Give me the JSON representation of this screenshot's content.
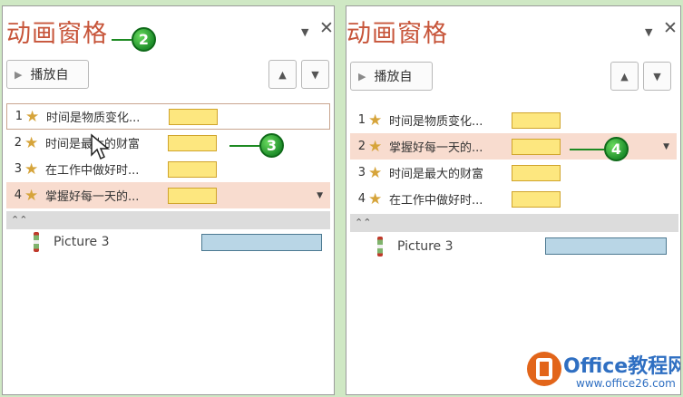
{
  "colors": {
    "title": "#c7553a",
    "effect_bar": "#fde77f",
    "picture_bar": "#b9d6e6",
    "selected_row": "#f8dccf",
    "callout": "#1f8f2b",
    "watermark": "#2f6fc2"
  },
  "icons": {
    "dropdown": "caret-down-icon",
    "close": "close-icon",
    "play": "play-icon",
    "move_up": "arrow-up-icon",
    "move_down": "arrow-down-icon",
    "effect": "star-icon",
    "collapse": "chevron-up-double-icon",
    "picture": "picture-object-icon",
    "cursor": "hand-cursor-icon"
  },
  "left_panel": {
    "title": "动画窗格",
    "close_glyph": "✕",
    "dropdown_glyph": "▼",
    "play_label": "播放自",
    "up_glyph": "▲",
    "down_glyph": "▼",
    "items": [
      {
        "num": "1",
        "star": "★",
        "name": "时间是物质变化..."
      },
      {
        "num": "2",
        "star": "★",
        "name": "时间是最大的财富"
      },
      {
        "num": "3",
        "star": "★",
        "name": "在工作中做好时..."
      },
      {
        "num": "4",
        "star": "★",
        "name": "掌握好每一天的..."
      }
    ],
    "item_dropdown": "▼",
    "collapse_glyph": "⌃⌃",
    "picture_label": "Picture 3",
    "callouts": [
      "2",
      "3"
    ]
  },
  "right_panel": {
    "title": "动画窗格",
    "close_glyph": "✕",
    "dropdown_glyph": "▼",
    "play_label": "播放自",
    "up_glyph": "▲",
    "down_glyph": "▼",
    "items": [
      {
        "num": "1",
        "star": "★",
        "name": "时间是物质变化..."
      },
      {
        "num": "2",
        "star": "★",
        "name": "掌握好每一天的..."
      },
      {
        "num": "3",
        "star": "★",
        "name": "时间是最大的财富"
      },
      {
        "num": "4",
        "star": "★",
        "name": "在工作中做好时..."
      }
    ],
    "item_dropdown": "▼",
    "collapse_glyph": "⌃⌃",
    "picture_label": "Picture 3",
    "callouts": [
      "4"
    ]
  },
  "watermark": {
    "brand": "Office教程网",
    "url": "www.office26.com"
  }
}
